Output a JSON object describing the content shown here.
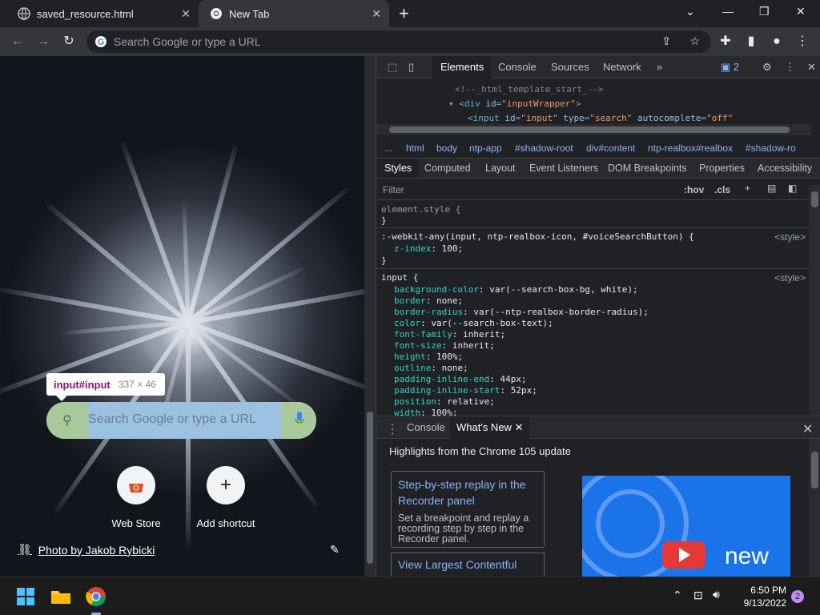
{
  "tabs": [
    {
      "title": "saved_resource.html",
      "active": false
    },
    {
      "title": "New Tab",
      "active": true
    }
  ],
  "toolbar": {
    "omnibox_placeholder": "Search Google or type a URL"
  },
  "ntp": {
    "tooltip_tag": "input#input",
    "tooltip_size": "337 × 46",
    "search_placeholder": "Search Google or type a URL",
    "shortcuts": [
      {
        "label": "Web Store",
        "icon": "chrome-web-store-icon"
      },
      {
        "label": "Add shortcut",
        "icon": "plus-icon"
      }
    ],
    "photo_credit": "Photo by Jakob Rybicki"
  },
  "devtools": {
    "main_tabs": [
      "Elements",
      "Console",
      "Sources",
      "Network"
    ],
    "active_main_tab": "Elements",
    "issues_count": "2",
    "dom": {
      "line1": "<!--_html_template_start_-->",
      "line2_tag": "div",
      "line2_attr": "id",
      "line2_val": "\"inputWrapper\"",
      "line3_tag": "input",
      "line3_attr1": "id",
      "line3_val1": "\"input\"",
      "line3_attr2": "type",
      "line3_val2": "\"search\"",
      "line3_attr3": "autocomplete",
      "line3_val3": "\"off\""
    },
    "breadcrumbs": [
      "...",
      "html",
      "body",
      "ntp-app",
      "#shadow-root",
      "div#content",
      "ntp-realbox#realbox",
      "#shadow-ro"
    ],
    "sub_tabs": [
      "Styles",
      "Computed",
      "Layout",
      "Event Listeners",
      "DOM Breakpoints",
      "Properties",
      "Accessibility"
    ],
    "active_sub_tab": "Styles",
    "filter_placeholder": "Filter",
    "hov": ":hov",
    "cls": ".cls",
    "styles": {
      "rule1_selector": "element.style {",
      "rule1_close": "}",
      "rule2_selector": ":-webkit-any(input, ntp-realbox-icon, #voiceSearchButton) {",
      "rule2_source": "<style>",
      "rule2_prop": "z-index",
      "rule2_val": "100;",
      "rule2_close": "}",
      "rule3_selector": "input {",
      "rule3_source": "<style>",
      "rule3_props": [
        {
          "name": "background-color",
          "value": "var(--search-box-bg, white);"
        },
        {
          "name": "border",
          "value": "none;"
        },
        {
          "name": "border-radius",
          "value": "var(--ntp-realbox-border-radius);"
        },
        {
          "name": "color",
          "value": "var(--search-box-text);"
        },
        {
          "name": "font-family",
          "value": "inherit;"
        },
        {
          "name": "font-size",
          "value": "inherit;"
        },
        {
          "name": "height",
          "value": "100%;"
        },
        {
          "name": "outline",
          "value": "none;"
        },
        {
          "name": "padding-inline-end",
          "value": "44px;"
        },
        {
          "name": "padding-inline-start",
          "value": "52px;"
        },
        {
          "name": "position",
          "value": "relative;"
        },
        {
          "name": "width",
          "value": "100%;"
        }
      ]
    },
    "drawer": {
      "tabs": [
        "Console",
        "What's New"
      ],
      "active_tab": "What's New",
      "heading": "Highlights from the Chrome 105 update",
      "card1_title": "Step-by-step replay in the Recorder panel",
      "card1_desc": "Set a breakpoint and replay a recording step by step in the Recorder panel.",
      "card2_title": "View Largest Contentful",
      "video_text": "new"
    }
  },
  "taskbar": {
    "time": "6:50 PM",
    "date": "9/13/2022",
    "notification_count": "2"
  },
  "colors": {
    "accent": "#8ab4f8",
    "devtools_bg": "#202124",
    "tooltip_tag": "#881280"
  }
}
